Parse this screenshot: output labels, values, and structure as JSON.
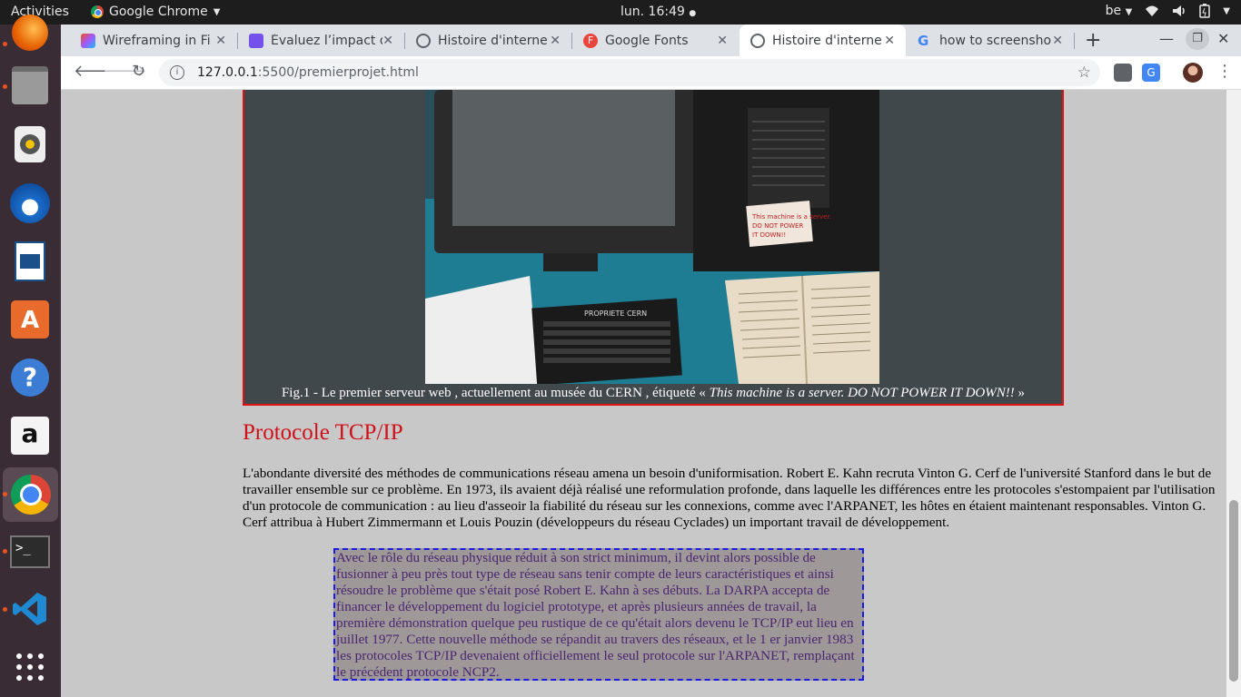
{
  "os": {
    "activities_label": "Activities",
    "app_name": "Google Chrome",
    "clock": "lun. 16:49",
    "keyboard_layout": "be"
  },
  "dock": {
    "items": [
      "firefox-icon",
      "files-icon",
      "rhythmbox-icon",
      "thunderbird-icon",
      "writer-icon",
      "software-center-icon",
      "help-icon",
      "amazon-icon",
      "chrome-icon",
      "terminal-icon",
      "vscode-icon",
      "apps-grid-icon"
    ]
  },
  "tabs": [
    {
      "title": "Wireframing in Fi",
      "favicon": "figma-icon"
    },
    {
      "title": "Évaluez l’impact d",
      "favicon": "openclassrooms-icon"
    },
    {
      "title": "Histoire d'interne",
      "favicon": "globe-icon"
    },
    {
      "title": "Google Fonts",
      "favicon": "google-fonts-icon"
    },
    {
      "title": "Histoire d'interne",
      "favicon": "globe-icon",
      "active": true
    },
    {
      "title": "how to screensho",
      "favicon": "google-icon"
    }
  ],
  "address_bar": {
    "host": "127.0.0.1",
    "path": ":5500/premierprojet.html"
  },
  "page": {
    "figure_caption_prefix": "Fig.1 - Le premier serveur web , actuellement au musée du CERN , étiqueté « ",
    "figure_caption_quote": "This machine is a server. DO NOT POWER IT DOWN!!",
    "figure_caption_suffix": " »",
    "section_title": "Protocole TCP/IP",
    "paragraph": "L'abondante diversité des méthodes de communications réseau amena un besoin d'uniformisation. Robert E. Kahn recruta Vinton G. Cerf de l'université Stanford dans le but de travailler ensemble sur ce problème. En 1973, ils avaient déjà réalisé une reformulation profonde, dans laquelle les différences entre les protocoles s'estompaient par l'utilisation d'un protocole de communication : au lieu d'asseoir la fiabilité du réseau sur les connexions, comme avec l'ARPANET, les hôtes en étaient maintenant responsables. Vinton G. Cerf attribua à Hubert Zimmermann et Louis Pouzin (développeurs du réseau Cyclades) un important travail de développement.",
    "boxed_paragraph": "Avec le rôle du réseau physique réduit à son strict minimum, il devint alors possible de fusionner à peu près tout type de réseau sans tenir compte de leurs caractéristiques et ainsi résoudre le problème que s'était posé Robert E. Kahn à ses débuts. La DARPA accepta de financer le développement du logiciel prototype, et après plusieurs années de travail, la première démonstration quelque peu rustique de ce qu'était alors devenu le TCP/IP eut lieu en juillet 1977. Cette nouvelle méthode se répandit au travers des réseaux, et le 1 er janvier 1983 les protocoles TCP/IP devenaient officiellement le seul protocole sur l'ARPANET, remplaçant le précédent protocole NCP2.",
    "photo_labels": {
      "keyboard_label": "PROPRIETE CERN",
      "sticker_text": "This machine is a server. DO NOT POWER IT DOWN!!"
    }
  },
  "colors": {
    "figure_border": "#dd1111",
    "heading": "#d0101a",
    "box_border": "#1a1ae6",
    "box_text": "#4b2670"
  }
}
